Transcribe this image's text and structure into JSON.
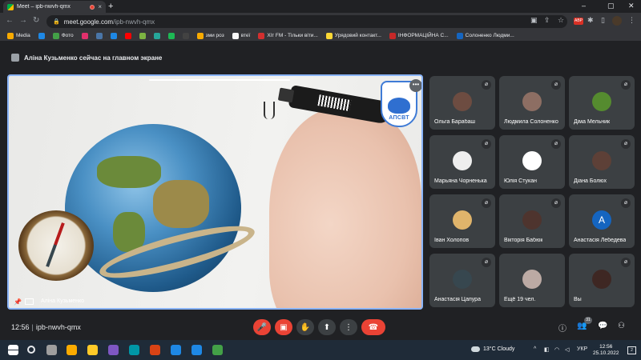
{
  "browser": {
    "tab_title": "Meet – ipb-nwvh-qmx",
    "tab_close": "×",
    "new_tab": "+",
    "url_host": "meet.google.com",
    "url_path": "/ipb-nwvh-qmx",
    "ext_badge": "ABP",
    "window_controls": [
      "–",
      "▢",
      "✕"
    ]
  },
  "bookmarks": [
    {
      "label": "Media",
      "color": "#f9ab00"
    },
    {
      "label": "",
      "color": "#1e88e5"
    },
    {
      "label": "Фото",
      "color": "#43a047"
    },
    {
      "label": "",
      "color": "#e1306c"
    },
    {
      "label": "",
      "color": "#4a76a8"
    },
    {
      "label": "",
      "color": "#1e88e5"
    },
    {
      "label": "",
      "color": "#ff0000"
    },
    {
      "label": "",
      "color": "#7cb342"
    },
    {
      "label": "",
      "color": "#26a69a"
    },
    {
      "label": "",
      "color": "#1db954"
    },
    {
      "label": "",
      "color": "#424242"
    },
    {
      "label": "зми роз",
      "color": "#f9ab00"
    },
    {
      "label": "втеї",
      "color": "#fafafa"
    },
    {
      "label": "Хіт FM - Тільки віти...",
      "color": "#d32f2f"
    },
    {
      "label": "Урядовий контакт...",
      "color": "#fdd835"
    },
    {
      "label": "ІНФОРМАЦІЙНА С...",
      "color": "#c62828"
    },
    {
      "label": "Солоненко Людми...",
      "color": "#1565c0"
    }
  ],
  "meet": {
    "presenter_text": "Аліна Кузьменко сейчас на главном экране",
    "main_name": "Аліна Кузьменко",
    "logo_text": "АПСВТ",
    "more_icon": "•••",
    "participants": [
      {
        "name": "Ольга Барабаш",
        "avatar_color": "#6d4c41"
      },
      {
        "name": "Людмила Солоненко",
        "avatar_color": "#8d6e63"
      },
      {
        "name": "Діма Мельник",
        "avatar_color": "#558b2f"
      },
      {
        "name": "Марьяна Чорненька",
        "avatar_color": "#eeeeee"
      },
      {
        "name": "Юлія Стукан",
        "avatar_color": "#ffffff"
      },
      {
        "name": "Діана Болюх",
        "avatar_color": "#5d4037"
      },
      {
        "name": "Іван Холопов",
        "avatar_color": "#e0b46b"
      },
      {
        "name": "Вікторія Бабюк",
        "avatar_color": "#4e342e"
      },
      {
        "name": "Анастасія Лебедева",
        "avatar_letter": "A",
        "avatar_color": "#1565c0"
      },
      {
        "name": "Анастасія Цапура",
        "avatar_color": "#37474f"
      },
      {
        "name": "Ещё 19 чел.",
        "avatar_color": "#bcaaa4"
      },
      {
        "name": "Вы",
        "avatar_color": "#3e2723"
      }
    ],
    "mute_icon": "🎙̸",
    "time": "12:56",
    "separator": "|",
    "meeting_code": "ipb-nwvh-qmx",
    "controls": {
      "mic": "🎤",
      "cam": "▣",
      "hand": "✋",
      "present": "⬆",
      "more": "⋮",
      "end": "☎"
    },
    "people_count": "31",
    "right_icons": {
      "info": "ⓘ",
      "people": "👥",
      "chat": "💬",
      "activities": "⚇"
    }
  },
  "taskbar": {
    "weather": "13°C  Cloudy",
    "lang": "УКР",
    "time": "12:56",
    "date": "25.10.2022",
    "notifications": "2",
    "app_colors": [
      "#ffffff",
      "#9e9e9e",
      "#f9ab00",
      "#ffca28",
      "#7e57c2",
      "#0097a7",
      "#d84315",
      "#1e88e5",
      "#1e88e5",
      "#43a047"
    ]
  }
}
